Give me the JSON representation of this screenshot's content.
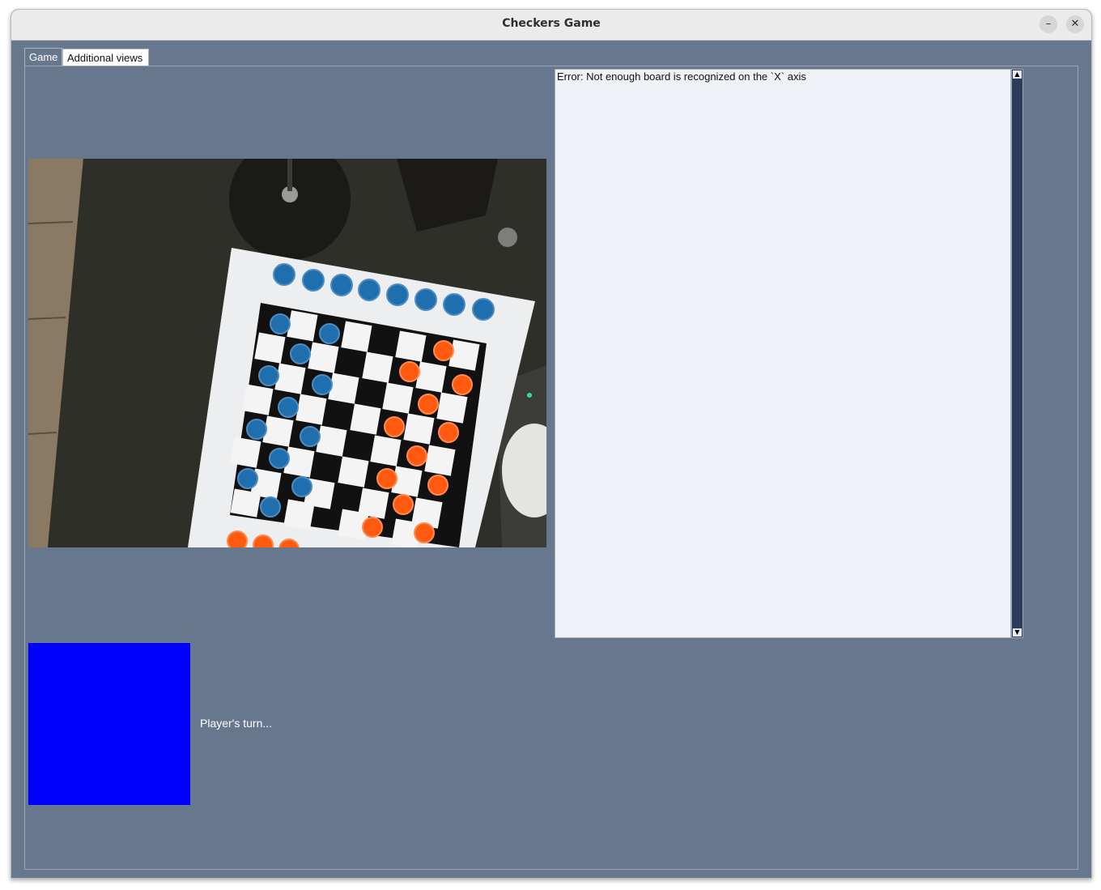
{
  "window": {
    "title": "Checkers Game",
    "minimize_glyph": "–",
    "close_glyph": "✕"
  },
  "tabs": [
    {
      "label": "Game",
      "selected": true
    },
    {
      "label": "Additional views",
      "selected": false
    }
  ],
  "log": {
    "text": "Error: Not enough board is recognized on the `X` axis"
  },
  "turn": {
    "color": "#0000ff",
    "label": "Player's turn..."
  },
  "camera": {
    "icon": "camera-feed-image"
  },
  "colors": {
    "window_bg": "#67788e",
    "blue_piece": "#1f6fae",
    "orange_piece": "#ff5a10"
  }
}
